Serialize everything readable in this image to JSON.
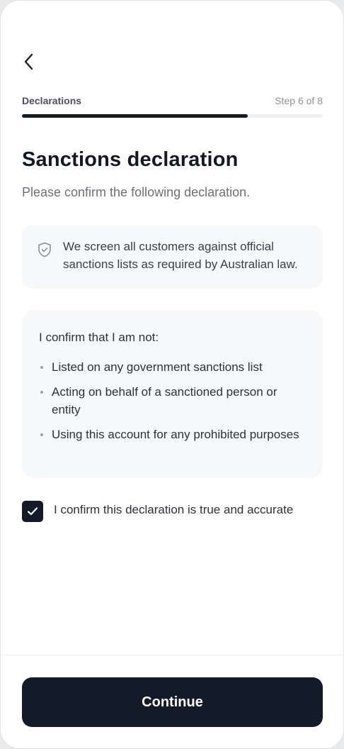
{
  "header": {
    "back_icon": "chevron-left-icon"
  },
  "progress": {
    "label": "Declarations",
    "step_text": "Step 6 of 8",
    "current_step": 6,
    "total_steps": 8,
    "fill_fraction": 0.75
  },
  "page": {
    "title": "Sanctions declaration",
    "subtitle": "Please confirm the following declaration."
  },
  "info": {
    "icon": "shield-check-icon",
    "text": "We screen all customers against official sanctions lists as required by Australian law."
  },
  "declaration": {
    "intro": "I confirm that I am not:",
    "items": [
      "Listed on any government sanctions list",
      "Acting on behalf of a sanctioned person or entity",
      "Using this account for any prohibited purposes"
    ]
  },
  "confirm": {
    "checked": true,
    "label": "I confirm this declaration is true and accurate"
  },
  "footer": {
    "continue_label": "Continue"
  },
  "colors": {
    "primary": "#131a28",
    "card_bg": "#f7f8fa",
    "muted_text": "#6b7079"
  }
}
